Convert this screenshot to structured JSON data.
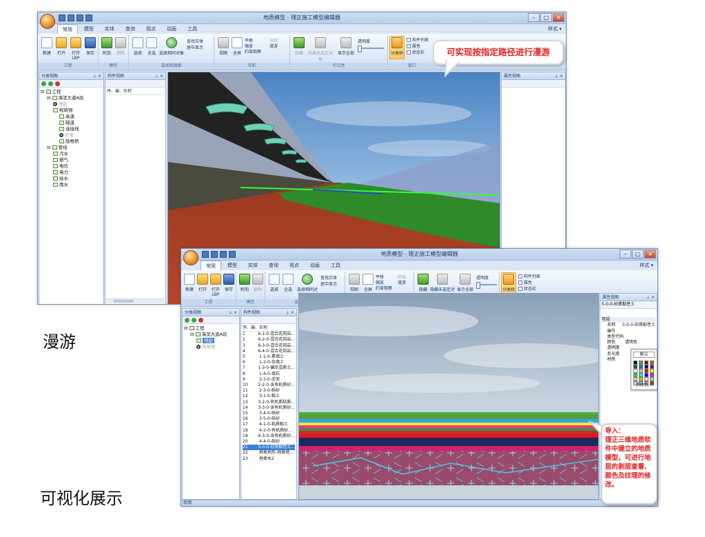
{
  "captions": {
    "roaming": "漫游",
    "visualization": "可视化展示"
  },
  "callouts": {
    "roam_path": "可实现按指定路径进行漫游",
    "import_title": "导入：",
    "import_body": "理正三维地质软件中建立的地质模型，可进行地层的剥层查看、颜色及纹理的修改。"
  },
  "app": {
    "title": "地质模型 - 理正施工模型编辑器",
    "tabs": [
      "常用",
      "模型",
      "实体",
      "查询",
      "视点",
      "动画",
      "工具"
    ],
    "active_tab": "常用",
    "style_menu": "样式 ▾",
    "ribbon": {
      "new": "新建",
      "open": "打开",
      "open_lbp": "打开LBP",
      "save": "保存",
      "attach": "附加",
      "delete": "删除",
      "select": "选择",
      "select_all": "全选",
      "select_same": "选择相同对象",
      "find_entity": "查找实体",
      "center_show": "居中显示",
      "view": "视图",
      "fullscreen": "全屏",
      "pan": "平移",
      "zoom": "缩放",
      "orbit": "环绕",
      "roam": "漫游",
      "constrained_view": "约束观察",
      "hide": "隐藏",
      "hide_unselected": "隐藏未选定对象",
      "show_all": "显示全部",
      "transparency": "透明度",
      "zone_view": "分类树",
      "component_list": "构件列表",
      "properties": "属性",
      "status_bar": "状态栏",
      "groups": {
        "project": "工程",
        "model": "模型",
        "select_search": "选择和搜索",
        "navigate": "导航",
        "visibility": "可见性",
        "window": "窗口"
      }
    },
    "panels": {
      "tree": "分类视图",
      "list": "构件视图",
      "props": "属性视图",
      "list_cols": "序、编、名称"
    },
    "tree1": [
      {
        "label": "工程",
        "level": 0,
        "icon": "tree"
      },
      {
        "label": "海滨大道A段",
        "level": 1,
        "icon": "tree"
      },
      {
        "label": "地层",
        "level": 2,
        "icon": "ring",
        "dim": true
      },
      {
        "label": "构筑物",
        "level": 2,
        "icon": "tree"
      },
      {
        "label": "高速",
        "level": 3,
        "icon": "tree"
      },
      {
        "label": "隧道",
        "level": 3,
        "icon": "tree"
      },
      {
        "label": "连接线",
        "level": 3,
        "icon": "tree"
      },
      {
        "label": "护坡",
        "level": 3,
        "icon": "ring",
        "dim": true
      },
      {
        "label": "隐框桥",
        "level": 3,
        "icon": "tree"
      },
      {
        "label": "管线",
        "level": 1,
        "icon": "tree"
      },
      {
        "label": "污水",
        "level": 2,
        "icon": "tree"
      },
      {
        "label": "燃气",
        "level": 2,
        "icon": "tree"
      },
      {
        "label": "电信",
        "level": 2,
        "icon": "tree"
      },
      {
        "label": "电力",
        "level": 2,
        "icon": "tree"
      },
      {
        "label": "给水",
        "level": 2,
        "icon": "tree"
      },
      {
        "label": "雨水",
        "level": 2,
        "icon": "tree"
      }
    ],
    "tree2": [
      {
        "label": "工程",
        "level": 0,
        "icon": "tree"
      },
      {
        "label": "海滨大道A段",
        "level": 1,
        "icon": "tree"
      },
      {
        "label": "地层",
        "level": 2,
        "icon": "tree",
        "sel": true
      },
      {
        "label": "构筑物",
        "level": 2,
        "icon": "ring",
        "dim": true
      }
    ],
    "list2": [
      [
        "1",
        "6-1-0-混合花岗岩..."
      ],
      [
        "2",
        "6-2-0-混合花岗岩..."
      ],
      [
        "3",
        "6-3-0-混合花岗岩..."
      ],
      [
        "4",
        "6-4-0-混合花岗岩..."
      ],
      [
        "5",
        "1-1-0-素填土"
      ],
      [
        "6",
        "1-2-0-杂填土"
      ],
      [
        "7",
        "1-3-0-碾压混质土..."
      ],
      [
        "8",
        "1-4-0-填石"
      ],
      [
        "9",
        "2-1-0-淤泥"
      ],
      [
        "10",
        "2-2-0-含有机质砂..."
      ],
      [
        "11",
        "2-3-0-砾砂"
      ],
      [
        "12",
        "3-1-0-黏土"
      ],
      [
        "13",
        "3-2-0-有机质粘质..."
      ],
      [
        "14",
        "3-3-0-含有机质砂..."
      ],
      [
        "15",
        "3-4-0-砾砂"
      ],
      [
        "16",
        "3-5-0-砾砂"
      ],
      [
        "17",
        "4-1-0-粘质黏土"
      ],
      [
        "18",
        "4-2-0-有机质砂..."
      ],
      [
        "19",
        "4-3-0-含有机质砂..."
      ],
      [
        "20",
        "4-4-0-砾砂"
      ],
      [
        "21",
        "5-0-0-砂质黏性土..."
      ],
      [
        "22",
        "地表地形-地表地..."
      ],
      [
        "23",
        "地表水2"
      ]
    ],
    "list2_selected": "21",
    "props2": {
      "object": "5-0-0-砂质黏性土",
      "group": "常规",
      "rows": [
        [
          "名称",
          "5-0-0-砂质黏性土"
        ],
        [
          "编号",
          ""
        ],
        [
          "类型代码",
          ""
        ],
        [
          "颜色",
          "透明色"
        ],
        [
          "透明度",
          ""
        ],
        [
          "反光度",
          ""
        ],
        [
          "材质",
          ""
        ]
      ],
      "color_default": "默认",
      "color_more": "其他色..."
    },
    "status": "就绪"
  },
  "colors": {
    "callout_text": "#e02020",
    "ribbon_bg": "#dce8f6",
    "selection": "#3d7fd6"
  }
}
